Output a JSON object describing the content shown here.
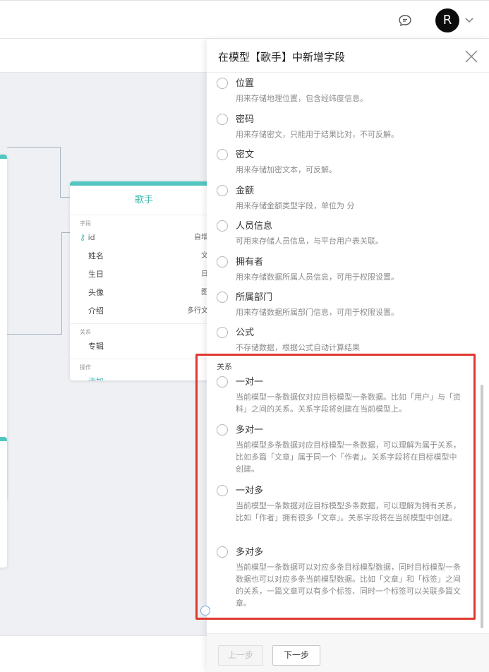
{
  "header": {
    "avatar_letter": "R",
    "icons": [
      "chat-icon",
      "chevron-down-icon"
    ]
  },
  "panel": {
    "title": "在模型【歌手】中新增字段",
    "options": [
      {
        "name": "位置",
        "desc": "用来存储地理位置，包含经纬度信息。"
      },
      {
        "name": "密码",
        "desc": "用来存储密文，只能用于结果比对，不可反解。"
      },
      {
        "name": "密文",
        "desc": "用来存储加密文本，可反解。"
      },
      {
        "name": "金额",
        "desc": "用来存储金额类型字段，单位为 分"
      },
      {
        "name": "人员信息",
        "desc": "可用来存储人员信息，与平台用户表关联。"
      },
      {
        "name": "拥有者",
        "desc": "用来存储数据所属人员信息，可用于权限设置。"
      },
      {
        "name": "所属部门",
        "desc": "用来存储数据所属部门信息，可用于权限设置。"
      },
      {
        "name": "公式",
        "desc": "不存储数据，根据公式自动计算结果"
      }
    ],
    "relation_group": "关系",
    "relations": [
      {
        "name": "一对一",
        "desc": "当前模型一条数据仅对应目标模型一条数据。比如「用户」与「资料」之间的关系。关系字段将创建在当前模型上。"
      },
      {
        "name": "多对一",
        "desc": "当前模型多条数据对应目标模型一条数据，可以理解为属于关系，比如多篇「文章」属于同一个「作者」。关系字段将在目标模型中创建。"
      },
      {
        "name": "一对多",
        "desc": "当前模型一条数据对应目标模型多条数据，可以理解为拥有关系，比如「作者」拥有很多「文章」。关系字段将在当前模型中创建。"
      },
      {
        "name": "多对多",
        "desc": "当前模型一条数据可以对应多条目标模型数据，同时目标模型一条数据也可以对应多条当前模型数据。比如「文章」和「标签」之间的关系，一篇文章可以有多个标签、同时一个标签可以关联多篇文章。"
      }
    ],
    "footer": {
      "prev": "上一步",
      "next": "下一步"
    }
  },
  "model_card": {
    "title": "歌手",
    "fields_label": "字段",
    "id_field": "id",
    "id_value": "自增",
    "fields": [
      {
        "name": "姓名",
        "value": "文"
      },
      {
        "name": "生日",
        "value": "日"
      },
      {
        "name": "头像",
        "value": "图"
      },
      {
        "name": "介绍",
        "value": "多行文"
      }
    ],
    "relations_label": "关系",
    "relation_field": "专辑",
    "actions_label": "操作",
    "add_label": "添加"
  }
}
